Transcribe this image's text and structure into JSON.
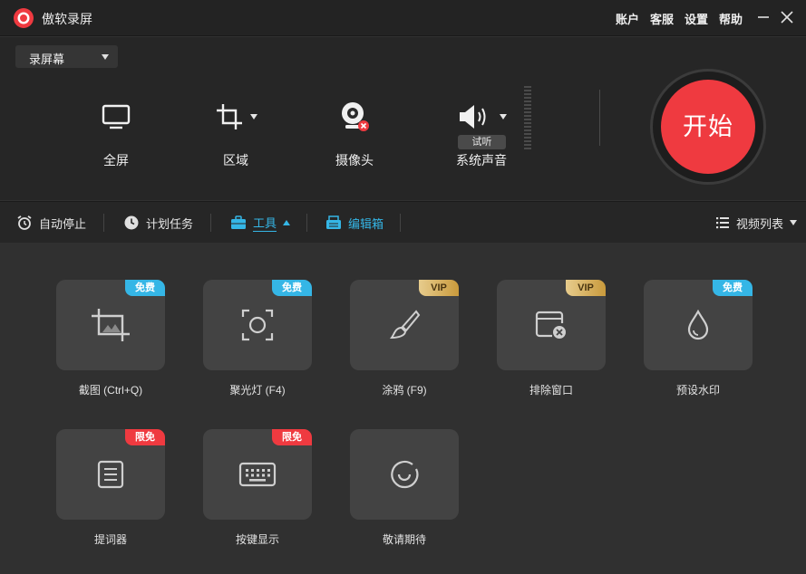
{
  "app": {
    "title": "傲软录屏"
  },
  "top_links": [
    "账户",
    "客服",
    "设置",
    "帮助"
  ],
  "record": {
    "mode": "录屏幕",
    "sources": {
      "fullscreen": "全屏",
      "area": "区域",
      "camera": "摄像头",
      "system_sound": "系统声音",
      "preview": "试听"
    },
    "start_label": "开始"
  },
  "toolbar": {
    "auto_stop": "自动停止",
    "schedule": "计划任务",
    "tools": "工具",
    "editor": "编辑箱",
    "video_list": "视频列表"
  },
  "tools": [
    {
      "label": "截图 (Ctrl+Q)",
      "badge": "免费",
      "icon": "screenshot-icon"
    },
    {
      "label": "聚光灯 (F4)",
      "badge": "免费",
      "icon": "spotlight-icon"
    },
    {
      "label": "涂鸦 (F9)",
      "badge": "VIP",
      "icon": "brush-icon"
    },
    {
      "label": "排除窗口",
      "badge": "VIP",
      "icon": "exclude-window-icon"
    },
    {
      "label": "预设水印",
      "badge": "免费",
      "icon": "watermark-drop-icon"
    },
    {
      "label": "提词器",
      "badge": "限免",
      "icon": "teleprompter-icon"
    },
    {
      "label": "按键显示",
      "badge": "限免",
      "icon": "keyboard-icon"
    },
    {
      "label": "敬请期待",
      "badge": "",
      "icon": "coming-soon-icon"
    }
  ],
  "colors": {
    "accent_blue": "#35b6e6",
    "start_red": "#ef3a40",
    "vip_gold": "#d6b062"
  }
}
